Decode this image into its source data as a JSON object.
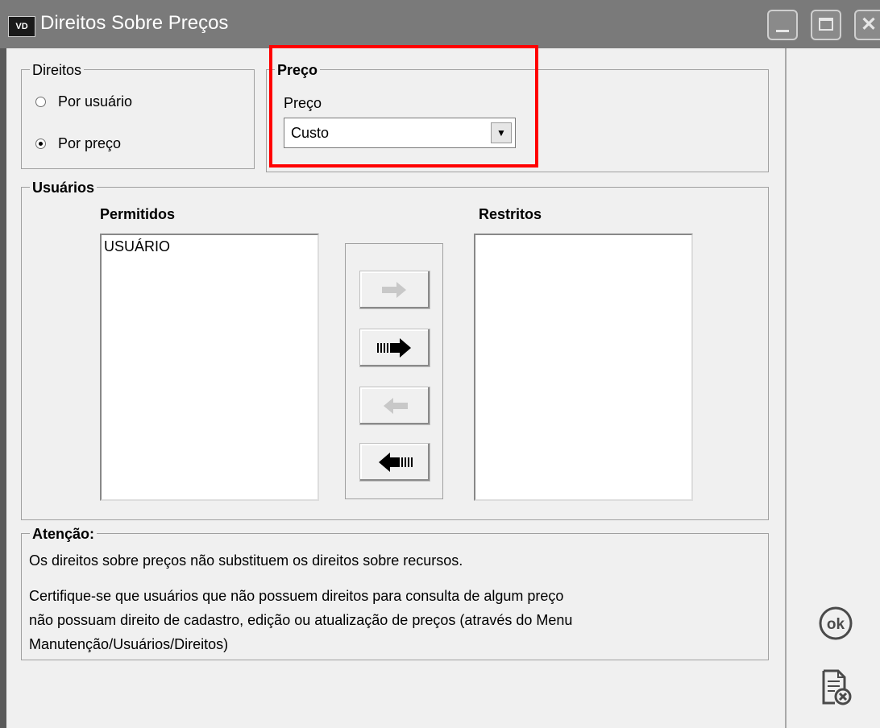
{
  "window": {
    "icon_text": "VD",
    "title": "Direitos Sobre Preços"
  },
  "direitos": {
    "title": "Direitos",
    "options": [
      {
        "label": "Por usuário",
        "checked": false
      },
      {
        "label": "Por preço",
        "checked": true
      }
    ]
  },
  "preco": {
    "group_title": "Preço",
    "field_label": "Preço",
    "selected": "Custo"
  },
  "usuarios": {
    "title": "Usuários",
    "permitidos_header": "Permitidos",
    "restritos_header": "Restritos",
    "permitidos": [
      "USUÁRIO"
    ],
    "restritos": []
  },
  "move_buttons": [
    {
      "name": "move-selected-right-button",
      "icon": "arrow-right-icon",
      "enabled": false
    },
    {
      "name": "move-all-right-button",
      "icon": "arrow-right-all-icon",
      "enabled": true
    },
    {
      "name": "move-selected-left-button",
      "icon": "arrow-left-icon",
      "enabled": false
    },
    {
      "name": "move-all-left-button",
      "icon": "arrow-left-all-icon",
      "enabled": true
    }
  ],
  "atencao": {
    "title": "Atenção:",
    "line1": "Os direitos sobre preços não substituem os direitos sobre recursos.",
    "line2a": "Certifique-se que usuários que não possuem direitos para consulta de algum preço",
    "line2b": "não possuam direito de cadastro, edição ou atualização de preços (através do Menu",
    "line2c": "Manutenção/Usuários/Direitos)"
  },
  "sidebar": {
    "ok_label": "ok",
    "cancel_icon": "document-cancel-icon"
  },
  "colors": {
    "highlight": "#ff0000",
    "titlebar": "#7a7a7a",
    "window_bg": "#f0f0f0"
  }
}
